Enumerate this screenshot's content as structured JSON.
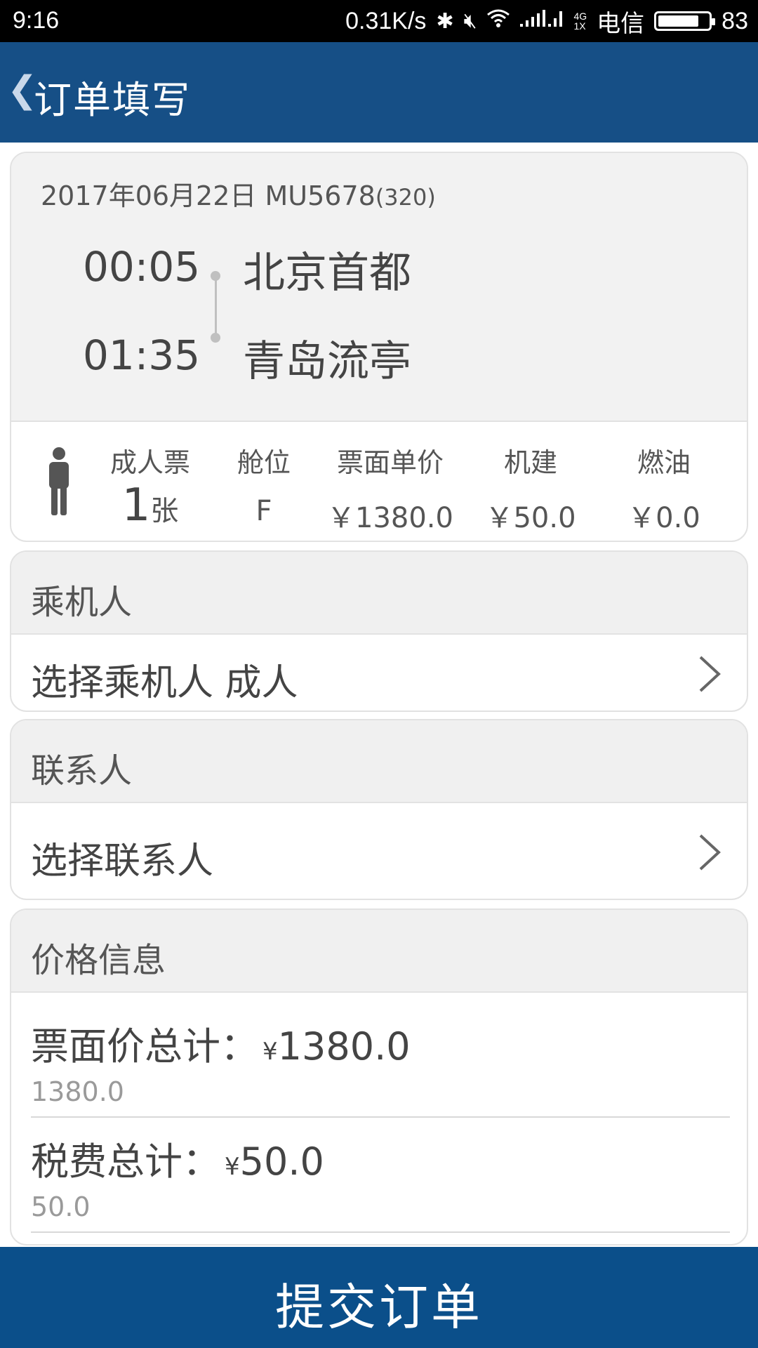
{
  "status_bar": {
    "time": "9:16",
    "net_speed": "0.31K/s",
    "network_top": "4G",
    "network_bottom": "1X",
    "carrier": "电信",
    "battery": "83",
    "battery_level": 0.83
  },
  "header": {
    "title": "订单填写"
  },
  "flight": {
    "date": "2017年06月22日 MU5678",
    "aircraft": "(320)",
    "depart_time": "00:05",
    "depart_city": "北京首都",
    "arrive_time": "01:35",
    "arrive_city": "青岛流亭"
  },
  "ticket": {
    "type_label": "成人票",
    "count": "1",
    "count_unit": "张",
    "cabin_label": "舱位",
    "cabin": "F",
    "price_label": "票面单价",
    "price": "￥1380.0",
    "airport_fee_label": "机建",
    "airport_fee": "￥50.0",
    "fuel_label": "燃油",
    "fuel": "￥0.0"
  },
  "passenger": {
    "section_title": "乘机人",
    "select_label": "选择乘机人 成人"
  },
  "contact": {
    "section_title": "联系人",
    "select_label": "选择联系人"
  },
  "price_info": {
    "section_title": "价格信息",
    "fare_total_label": "票面价总计：",
    "fare_total_currency": "¥",
    "fare_total_amount": "1380.0",
    "fare_total_sub": "1380.0",
    "tax_total_label": "税费总计：",
    "tax_total_currency": "¥",
    "tax_total_amount": "50.0",
    "tax_total_sub": "50.0"
  },
  "submit": {
    "label": "提交订单"
  },
  "colors": {
    "header_bg": "#164f86",
    "submit_bg": "#0b4f8a",
    "section_bg": "#f0f0f0"
  }
}
